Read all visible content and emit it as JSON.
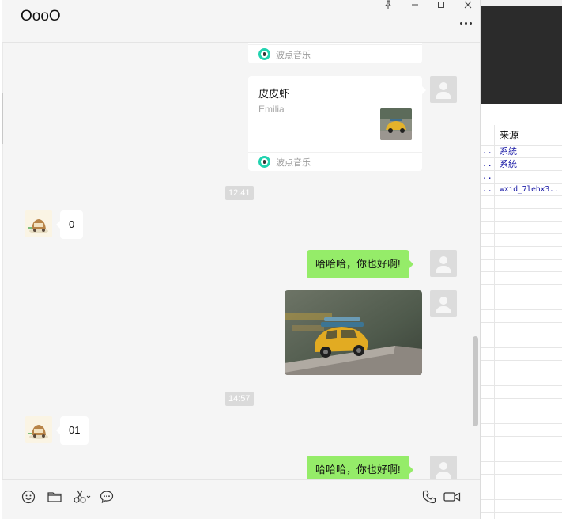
{
  "chat": {
    "title": "OooO",
    "music_source": "波点音乐",
    "song": {
      "title": "皮皮虾",
      "artist": "Emilia"
    },
    "timestamps": [
      "12:41",
      "14:57"
    ],
    "messages": {
      "in_1": "0",
      "out_1": "哈哈哈，你也好啊!",
      "in_2": "01",
      "out_2": "哈哈哈，你也好啊!"
    }
  },
  "background_table": {
    "header": "来源",
    "rows": [
      {
        "lead": "..",
        "value": "系統"
      },
      {
        "lead": "..",
        "value": "系統"
      },
      {
        "lead": "..",
        "value": ""
      },
      {
        "lead": "..",
        "value": "wxid_7lehx3.."
      }
    ]
  },
  "icons": {
    "window": [
      "pin-icon",
      "minimize-icon",
      "maximize-icon",
      "close-icon"
    ],
    "toolbar": [
      "emoji-icon",
      "folder-icon",
      "scissors-icon",
      "chat-history-icon",
      "phone-icon",
      "video-icon"
    ]
  },
  "colors": {
    "sent_bubble": "#95ec69",
    "received_bubble": "#ffffff",
    "chat_background": "#f5f5f5",
    "music_accent": "#22d3b0"
  }
}
